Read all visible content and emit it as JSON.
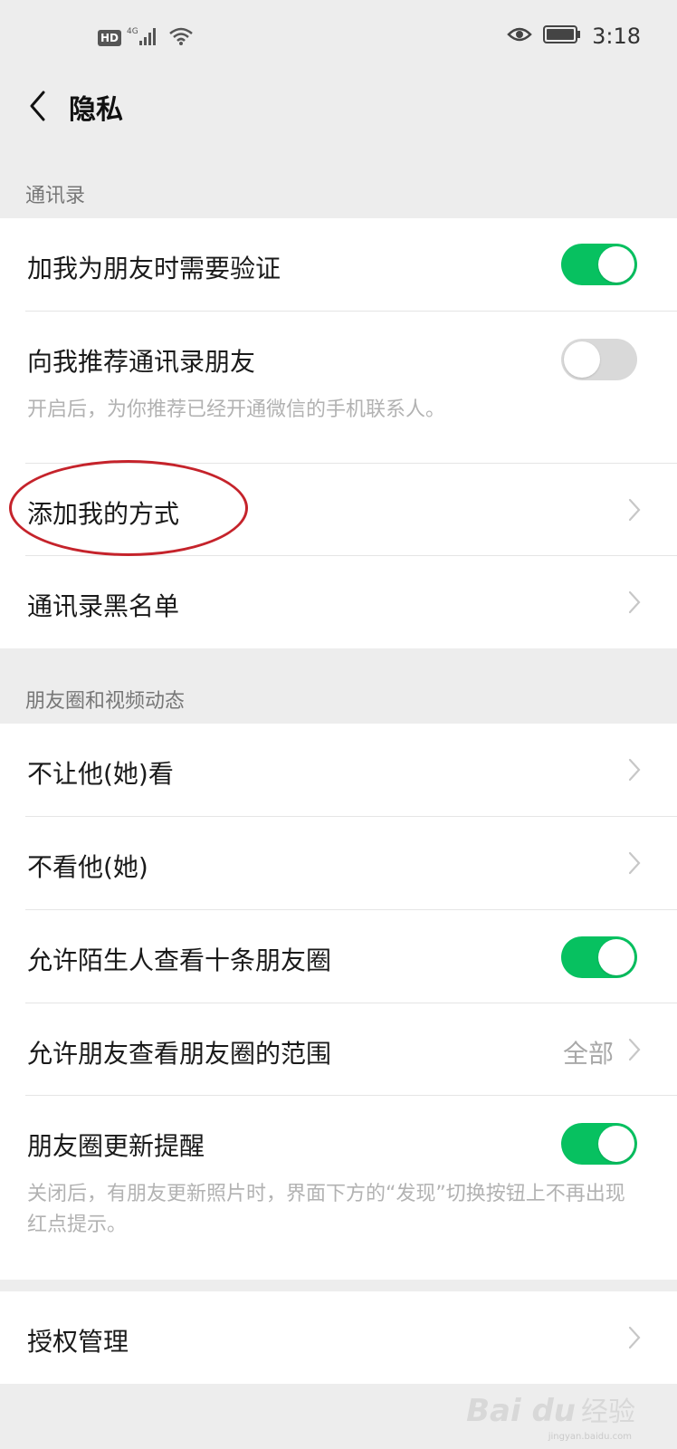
{
  "statusbar": {
    "hd": "HD",
    "network": "4G",
    "time": "3:18"
  },
  "navbar": {
    "title": "隐私"
  },
  "sections": {
    "contacts": {
      "header": "通讯录",
      "items": [
        {
          "label": "加我为朋友时需要验证",
          "toggle": true
        },
        {
          "label": "向我推荐通讯录朋友",
          "toggle": false,
          "desc": "开启后，为你推荐已经开通微信的手机联系人。"
        },
        {
          "label": "添加我的方式"
        },
        {
          "label": "通讯录黑名单"
        }
      ]
    },
    "moments": {
      "header": "朋友圈和视频动态",
      "items": [
        {
          "label": "不让他(她)看"
        },
        {
          "label": "不看他(她)"
        },
        {
          "label": "允许陌生人查看十条朋友圈",
          "toggle": true
        },
        {
          "label": "允许朋友查看朋友圈的范围",
          "value": "全部"
        },
        {
          "label": "朋友圈更新提醒",
          "toggle": true,
          "desc": "关闭后，有朋友更新照片时，界面下方的“发现”切换按钮上不再出现红点提示。"
        }
      ]
    },
    "auth": {
      "items": [
        {
          "label": "授权管理"
        }
      ]
    }
  },
  "watermark": {
    "logo": "Bai du",
    "text": "经验",
    "url": "jingyan.baidu.com"
  },
  "colors": {
    "accent": "#07c160",
    "background": "#ededed",
    "highlight": "#c5232b"
  }
}
